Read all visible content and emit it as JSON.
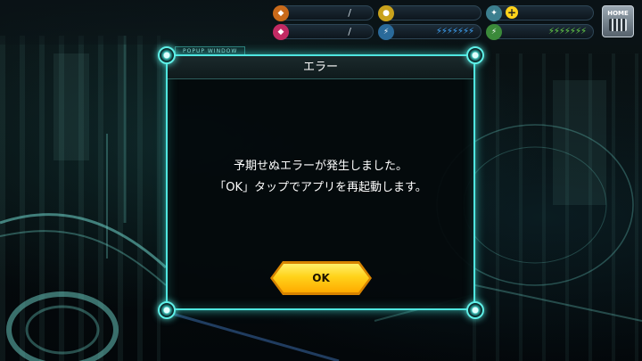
{
  "hud": {
    "bar1_slash": "/",
    "bar2_slash": "/",
    "bolts_blue": "⚡⚡⚡⚡⚡⚡⚡",
    "bolts_green": "⚡⚡⚡⚡⚡⚡⚡",
    "plus_symbol": "+",
    "home_label": "HOME"
  },
  "popup": {
    "tag": "POPUP WINDOW",
    "title": "エラー",
    "message_line1": "予期せぬエラーが発生しました。",
    "message_line2": "「OK」タップでアプリを再起動します。",
    "ok_label": "OK"
  },
  "colors": {
    "frame": "#4fe6e0",
    "ok_button": "#ffd21a",
    "background": "#05090b"
  },
  "icons": [
    "gem-icon",
    "ticket-icon",
    "coin-icon",
    "energy-icon",
    "stamina-icon",
    "add-icon",
    "home-icon"
  ]
}
